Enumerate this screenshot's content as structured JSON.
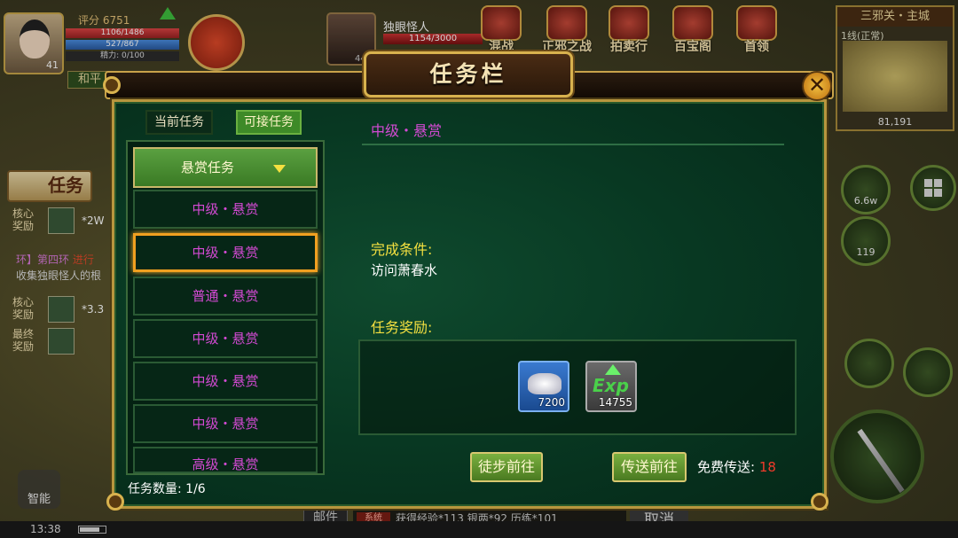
{
  "player": {
    "score": "评分 6751",
    "hp": "1106/1486",
    "mp": "527/867",
    "stamina": "精力: 0/100",
    "level": "41",
    "mode": "和平"
  },
  "target": {
    "name": "独眼怪人",
    "hp": "1154/3000",
    "level": "44"
  },
  "top_menu": [
    {
      "label": "混战",
      "icon": "war-banner-icon"
    },
    {
      "label": "正邪之战",
      "icon": "war-drum-icon"
    },
    {
      "label": "拍卖行",
      "icon": "abacus-icon"
    },
    {
      "label": "百宝阁",
      "icon": "treasure-pavilion-icon"
    },
    {
      "label": "首领",
      "icon": "boss-scroll-icon"
    }
  ],
  "minimap": {
    "title": "三邪关・主城",
    "line": "1线(正常)",
    "coords": "81,191"
  },
  "left_panel": {
    "task_button": "任务",
    "core_reward_label": "核心奖励",
    "core_reward_value": "*2W",
    "track_prefix": "环】第四环",
    "track_status": "进行",
    "track_desc": "收集独眼怪人的根",
    "core_reward_label_2": "核心奖励",
    "core_reward_value_2": "*3.3",
    "final_reward_label": "最终奖励"
  },
  "right_buttons": [
    {
      "value": "6.6w"
    },
    {
      "value": "119"
    }
  ],
  "bottom": {
    "time": "13:38",
    "smart_label": "智能",
    "mail_label": "邮件",
    "sys_tag": "系统",
    "sys_msg": "获得经验*113 银两*92 历练*101",
    "cancel_label": "取消"
  },
  "dialog": {
    "title": "任务栏",
    "close_glyph": "✕",
    "tabs": {
      "current": "当前任务",
      "available": "可接任务"
    },
    "list_header": "悬赏任务",
    "quests": [
      {
        "label": "中级・悬赏",
        "selected": false
      },
      {
        "label": "中级・悬赏",
        "selected": true
      },
      {
        "label": "普通・悬赏",
        "selected": false
      },
      {
        "label": "中级・悬赏",
        "selected": false
      },
      {
        "label": "中级・悬赏",
        "selected": false
      },
      {
        "label": "中级・悬赏",
        "selected": false
      },
      {
        "label": "高级・悬赏",
        "selected": false
      }
    ],
    "quest_count": "任务数量: 1/6",
    "detail": {
      "title": "中级・悬赏",
      "condition_label": "完成条件:",
      "condition_text": "访问萧春水",
      "reward_label": "任务奖励:",
      "rewards": [
        {
          "icon": "silver-ingot-icon",
          "count": "7200"
        },
        {
          "icon": "exp-icon",
          "count": "14755",
          "glyph": "Exp"
        }
      ]
    },
    "walk_button": "徒步前往",
    "teleport_button": "传送前往",
    "free_teleport_label": "免费传送:",
    "free_teleport_count": "18"
  },
  "colors": {
    "quest_text": "#d44ad4",
    "label_yellow": "#f4e040",
    "panel_green": "#083822",
    "gold_border": "#c8a24a",
    "free_count_red": "#f03a2a"
  }
}
